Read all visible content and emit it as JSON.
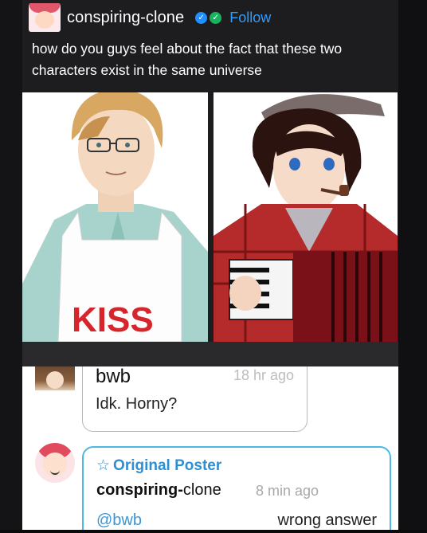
{
  "post": {
    "username": "conspiring-clone",
    "follow_label": "Follow",
    "text": "how do you guys feel about the fact that these two characters exist in the same universe",
    "image_left_text": "KISS"
  },
  "replies": [
    {
      "username": "bwb",
      "time": "18 hr ago",
      "text": "Idk. Horny?"
    },
    {
      "label": "Original Poster",
      "username_bold": "conspiring-",
      "username_rest": "clone",
      "time": "8 min ago",
      "mention": "@bwb",
      "text": "wrong answer"
    }
  ],
  "colors": {
    "background": "#0d0d0f",
    "post_bg": "#1d1d20",
    "follow": "#2e9dff",
    "verified_blue": "#1e90ff",
    "verified_green": "#19b35f",
    "op_border": "#4fb7e6",
    "op_label": "#2f8fd1"
  }
}
